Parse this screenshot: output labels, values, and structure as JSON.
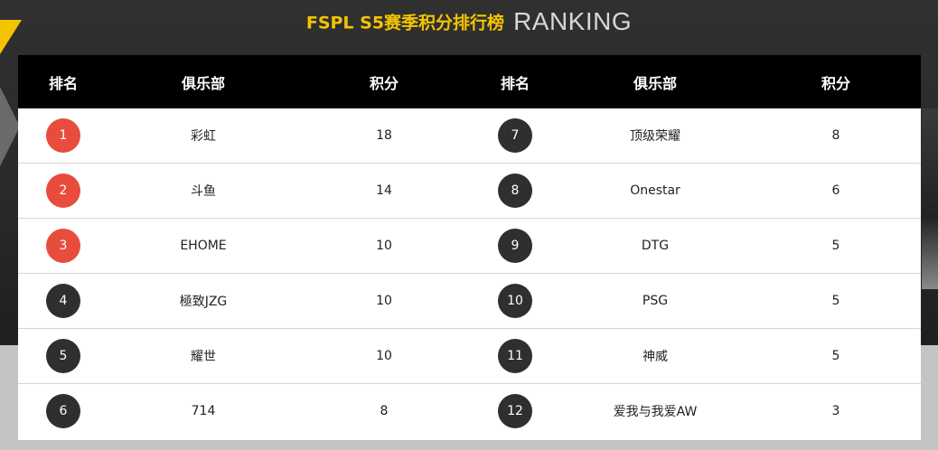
{
  "header": {
    "title_cn": "FSPL S5赛季积分排行榜",
    "title_en": "RANKING"
  },
  "table": {
    "columns": [
      "排名",
      "俱乐部",
      "积分",
      "排名",
      "俱乐部",
      "积分"
    ],
    "rows": [
      {
        "left": {
          "rank": "1",
          "club": "彩虹",
          "points": "18"
        },
        "right": {
          "rank": "7",
          "club": "顶级荣耀",
          "points": "8"
        }
      },
      {
        "left": {
          "rank": "2",
          "club": "斗鱼",
          "points": "14"
        },
        "right": {
          "rank": "8",
          "club": "Onestar",
          "points": "6"
        }
      },
      {
        "left": {
          "rank": "3",
          "club": "EHOME",
          "points": "10"
        },
        "right": {
          "rank": "9",
          "club": "DTG",
          "points": "5"
        }
      },
      {
        "left": {
          "rank": "4",
          "club": "極致JZG",
          "points": "10"
        },
        "right": {
          "rank": "10",
          "club": "PSG",
          "points": "5"
        }
      },
      {
        "left": {
          "rank": "5",
          "club": "耀世",
          "points": "10"
        },
        "right": {
          "rank": "11",
          "club": "神威",
          "points": "5"
        }
      },
      {
        "left": {
          "rank": "6",
          "club": "714",
          "points": "8"
        },
        "right": {
          "rank": "12",
          "club": "爱我与我爱AW",
          "points": "3"
        }
      }
    ]
  },
  "colors": {
    "accent": "#f5c400",
    "top_rank_badge": "#e84c3d",
    "rank_badge": "#2f2f2f",
    "header_bg": "#000000"
  }
}
